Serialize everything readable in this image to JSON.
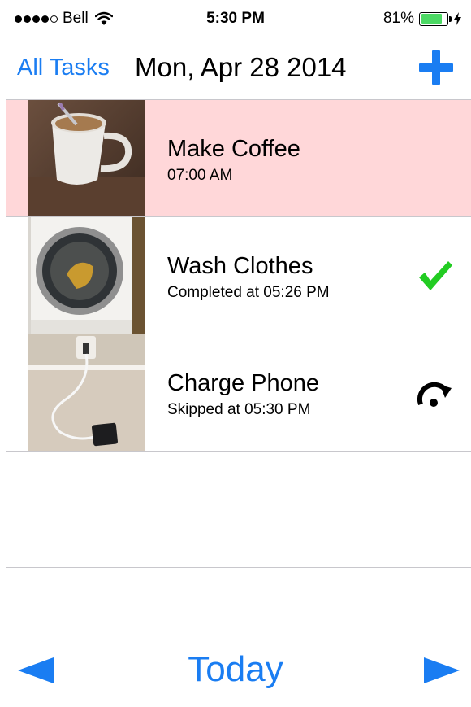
{
  "status_bar": {
    "carrier": "Bell",
    "time": "5:30 PM",
    "battery": "81%",
    "battery_level": 0.81,
    "signal_bars": 4,
    "signal_total": 5
  },
  "nav": {
    "back_label": "All Tasks",
    "title": "Mon, Apr 28 2014",
    "add_icon": "plus-icon"
  },
  "colors": {
    "accent": "#1a7df2",
    "highlight_row": "#ffd7d9",
    "completed_check": "#22cc22",
    "battery_fill": "#4cd964"
  },
  "tasks": [
    {
      "name": "Make Coffee",
      "subtitle": "07:00 AM",
      "state": "pending",
      "thumbnail": "coffee-mug-photo"
    },
    {
      "name": "Wash Clothes",
      "subtitle": "Completed at 05:26 PM",
      "state": "completed",
      "thumbnail": "washing-machine-photo",
      "status_icon": "checkmark-icon"
    },
    {
      "name": "Charge Phone",
      "subtitle": "Skipped at 05:30 PM",
      "state": "skipped",
      "thumbnail": "phone-charger-photo",
      "status_icon": "skip-icon"
    }
  ],
  "toolbar": {
    "today_label": "Today",
    "prev_icon": "left-arrow-icon",
    "next_icon": "right-arrow-icon"
  }
}
